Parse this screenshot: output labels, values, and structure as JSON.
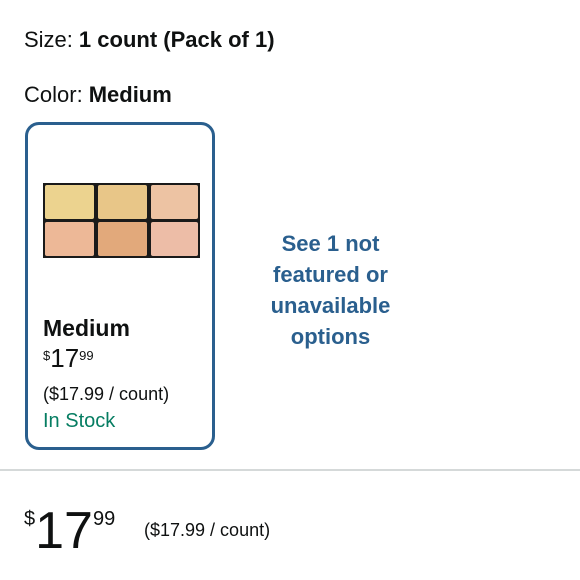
{
  "size": {
    "label": "Size:",
    "value": "1 count (Pack of 1)"
  },
  "color": {
    "label": "Color:",
    "value": "Medium"
  },
  "swatch": {
    "name": "Medium",
    "price_symbol": "$",
    "price_whole": "17",
    "price_fraction": "99",
    "unit_price": "($17.99 / count)",
    "availability": "In Stock",
    "palette_colors": [
      "#ecd38f",
      "#e8c688",
      "#edc3a3",
      "#edb897",
      "#e2a97b",
      "#edbda7"
    ]
  },
  "more_options": {
    "line1": "See 1 not",
    "line2": "featured or",
    "line3": "unavailable",
    "line4": "options"
  },
  "price": {
    "symbol": "$",
    "whole": "17",
    "fraction": "99",
    "unit_price": "($17.99 / count)"
  },
  "colors": {
    "accent": "#2a5f8e",
    "in_stock": "#067d62",
    "divider": "#d5d9d9"
  }
}
